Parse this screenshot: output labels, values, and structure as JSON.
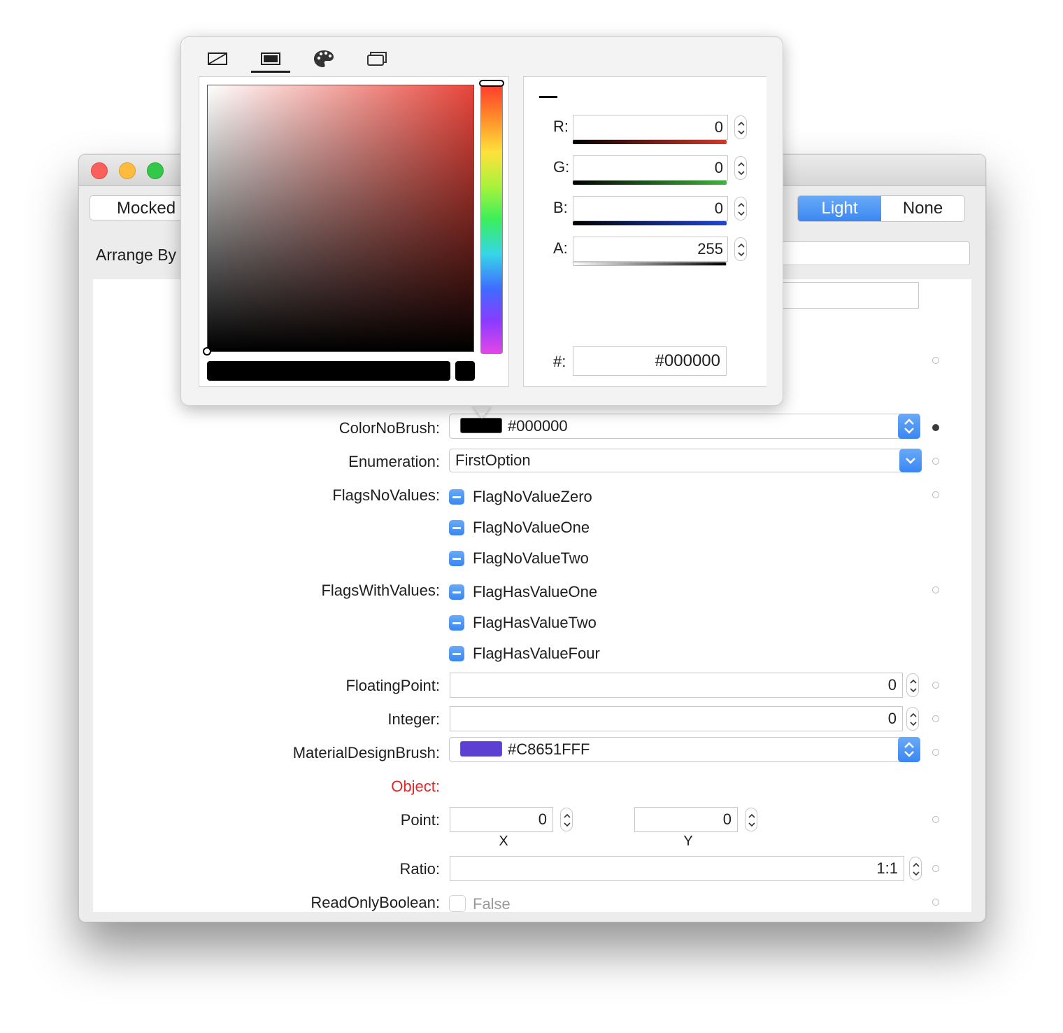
{
  "toolbar": {
    "mocked_label": "Mocked",
    "theme_options": [
      "Light",
      "None"
    ],
    "theme_selected": "Light"
  },
  "arrange": {
    "label": "Arrange By"
  },
  "properties": {
    "color_no_brush": {
      "label": "ColorNoBrush:",
      "swatch_color": "#000000",
      "value": "#000000"
    },
    "enumeration": {
      "label": "Enumeration:",
      "value": "FirstOption"
    },
    "flags_no_values": {
      "label": "FlagsNoValues:",
      "options": [
        "FlagNoValueZero",
        "FlagNoValueOne",
        "FlagNoValueTwo"
      ]
    },
    "flags_with_values": {
      "label": "FlagsWithValues:",
      "options": [
        "FlagHasValueOne",
        "FlagHasValueTwo",
        "FlagHasValueFour"
      ]
    },
    "floating_point": {
      "label": "FloatingPoint:",
      "value": "0"
    },
    "integer": {
      "label": "Integer:",
      "value": "0"
    },
    "material_design_brush": {
      "label": "MaterialDesignBrush:",
      "swatch_color": "#651FFF",
      "value": "#C8651FFF"
    },
    "object": {
      "label": "Object:"
    },
    "point": {
      "label": "Point:",
      "x": "0",
      "y": "0",
      "x_label": "X",
      "y_label": "Y"
    },
    "ratio": {
      "label": "Ratio:",
      "value": "1:1"
    },
    "read_only_boolean": {
      "label": "ReadOnlyBoolean:",
      "value": "False"
    }
  },
  "color_picker": {
    "tabs": [
      "no-color-icon",
      "solid-color-icon",
      "palette-icon",
      "resources-icon"
    ],
    "active_tab": "solid-color-icon",
    "current_color": "#000000",
    "channels": [
      {
        "label": "R:",
        "value": "0",
        "color": "#d23a2c"
      },
      {
        "label": "G:",
        "value": "0",
        "color": "#3fb43c"
      },
      {
        "label": "B:",
        "value": "0",
        "color": "#2146d8"
      },
      {
        "label": "A:",
        "value": "255",
        "color": "#000000"
      }
    ],
    "hex_label": "#:",
    "hex_value": "#000000"
  }
}
